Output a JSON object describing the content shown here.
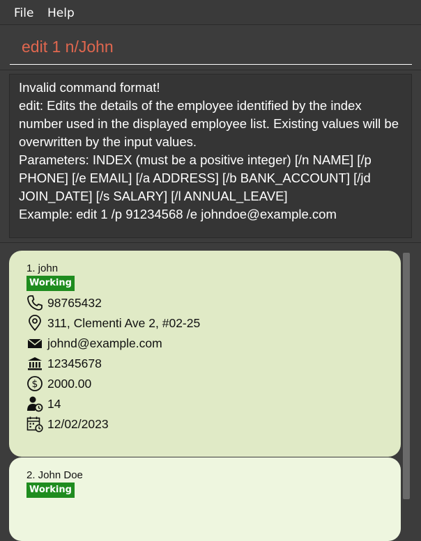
{
  "menu": {
    "file": "File",
    "help": "Help"
  },
  "command": {
    "value": "edit 1 n/John"
  },
  "result": {
    "lines": [
      "Invalid command format!",
      "edit: Edits the details of the employee identified by the index",
      "number used in the displayed employee list. Existing values will be",
      "overwritten by the input values.",
      "Parameters: INDEX (must be a positive integer) [/n NAME] [/p",
      "PHONE] [/e EMAIL] [/a ADDRESS] [/b BANK_ACCOUNT] [/jd",
      "JOIN_DATE] [/s SALARY] [/l ANNUAL_LEAVE]",
      "Example: edit 1 /p 91234568 /e johndoe@example.com"
    ]
  },
  "employees": [
    {
      "index_name": "1.  john",
      "status": "Working",
      "phone": "98765432",
      "address": "311, Clementi Ave 2, #02-25",
      "email": "johnd@example.com",
      "bank": "12345678",
      "salary": "2000.00",
      "leave": "14",
      "join_date": "12/02/2023",
      "icons": [
        "phone-icon",
        "location-pin-icon",
        "mail-icon",
        "bank-icon",
        "dollar-icon",
        "person-clock-icon",
        "calendar-clock-icon"
      ]
    },
    {
      "index_name": "2.  John Doe",
      "status": "Working"
    }
  ],
  "colors": {
    "background": "#3c3c3c",
    "command_text": "#e0674f",
    "card_selected": "#e0eac6",
    "card": "#eef6df",
    "badge": "#1f8c1f"
  }
}
